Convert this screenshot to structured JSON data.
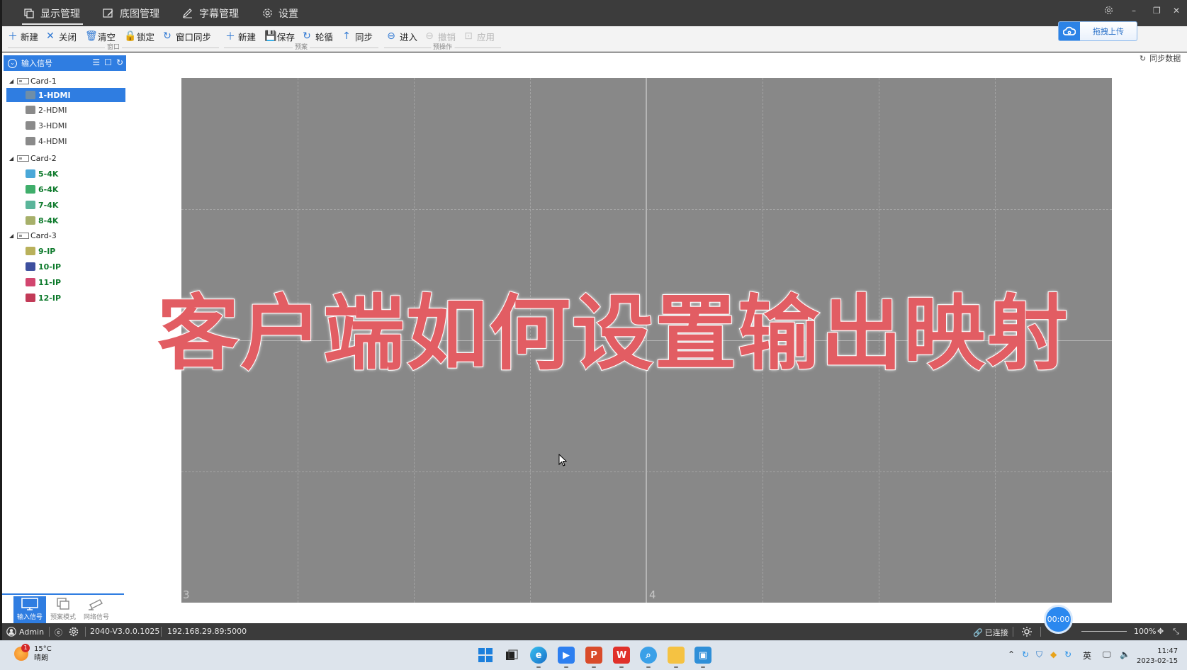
{
  "tabs": [
    {
      "label": "显示管理",
      "icon": "copy-icon",
      "active": true
    },
    {
      "label": "底图管理",
      "icon": "edit-image-icon",
      "active": false
    },
    {
      "label": "字幕管理",
      "icon": "pen-icon",
      "active": false
    },
    {
      "label": "设置",
      "icon": "gear-icon",
      "active": false
    }
  ],
  "toolbar": {
    "window_group": {
      "label": "窗口",
      "buttons": [
        {
          "label": "新建",
          "icon": "plus-icon"
        },
        {
          "label": "关闭",
          "icon": "close-icon"
        },
        {
          "label": "清空",
          "icon": "trash-icon"
        },
        {
          "label": "锁定",
          "icon": "lock-icon"
        },
        {
          "label": "窗口同步",
          "icon": "sync-icon"
        }
      ]
    },
    "preset_group": {
      "label": "预案",
      "buttons": [
        {
          "label": "新建",
          "icon": "plus-icon"
        },
        {
          "label": "保存",
          "icon": "save-icon"
        },
        {
          "label": "轮循",
          "icon": "loop-icon"
        },
        {
          "label": "同步",
          "icon": "upload-arrow-icon"
        }
      ]
    },
    "pre_group": {
      "label": "预操作",
      "buttons": [
        {
          "label": "进入",
          "icon": "enter-icon",
          "enabled": true
        },
        {
          "label": "撤销",
          "icon": "undo-icon",
          "enabled": false
        },
        {
          "label": "应用",
          "icon": "apply-icon",
          "enabled": false
        }
      ]
    },
    "upload_label": "拖拽上传"
  },
  "panel": {
    "title": "输入信号",
    "sync_data_label": "同步数据",
    "cards": [
      {
        "name": "Card-1",
        "signals": [
          {
            "label": "1-HDMI",
            "kind": "hdmi",
            "selected": true
          },
          {
            "label": "2-HDMI",
            "kind": "hdmi"
          },
          {
            "label": "3-HDMI",
            "kind": "hdmi"
          },
          {
            "label": "4-HDMI",
            "kind": "hdmi"
          }
        ]
      },
      {
        "name": "Card-2",
        "signals": [
          {
            "label": "5-4K",
            "kind": "4k",
            "color": "#4aa8d8"
          },
          {
            "label": "6-4K",
            "kind": "4k",
            "color": "#3fae6b"
          },
          {
            "label": "7-4K",
            "kind": "4k",
            "color": "#5ab59a"
          },
          {
            "label": "8-4K",
            "kind": "4k",
            "color": "#a7b06a"
          }
        ]
      },
      {
        "name": "Card-3",
        "signals": [
          {
            "label": "9-IP",
            "kind": "ip",
            "color": "#b9b15b"
          },
          {
            "label": "10-IP",
            "kind": "ip",
            "color": "#3d4f9e"
          },
          {
            "label": "11-IP",
            "kind": "ip",
            "color": "#d2466f"
          },
          {
            "label": "12-IP",
            "kind": "ip",
            "color": "#c23a57"
          }
        ]
      }
    ],
    "bottom_tabs": [
      {
        "label": "输入信号",
        "icon": "monitor-icon",
        "active": true
      },
      {
        "label": "预案模式",
        "icon": "layers-icon",
        "active": false
      },
      {
        "label": "网络信号",
        "icon": "camera-icon",
        "active": false
      }
    ]
  },
  "canvas": {
    "screens": [
      "3",
      "4"
    ],
    "overlay_title": "客户端如何设置输出映射"
  },
  "status": {
    "user": "Admin",
    "version": "2040-V3.0.0.1025",
    "address": "192.168.29.89:5000",
    "connection": "已连接",
    "zoom": "100%",
    "recording": "00:00"
  },
  "taskbar": {
    "weather_badge": "1",
    "temperature": "15°C",
    "condition": "晴朗",
    "ime": "英",
    "time": "11:47",
    "date": "2023-02-15"
  }
}
